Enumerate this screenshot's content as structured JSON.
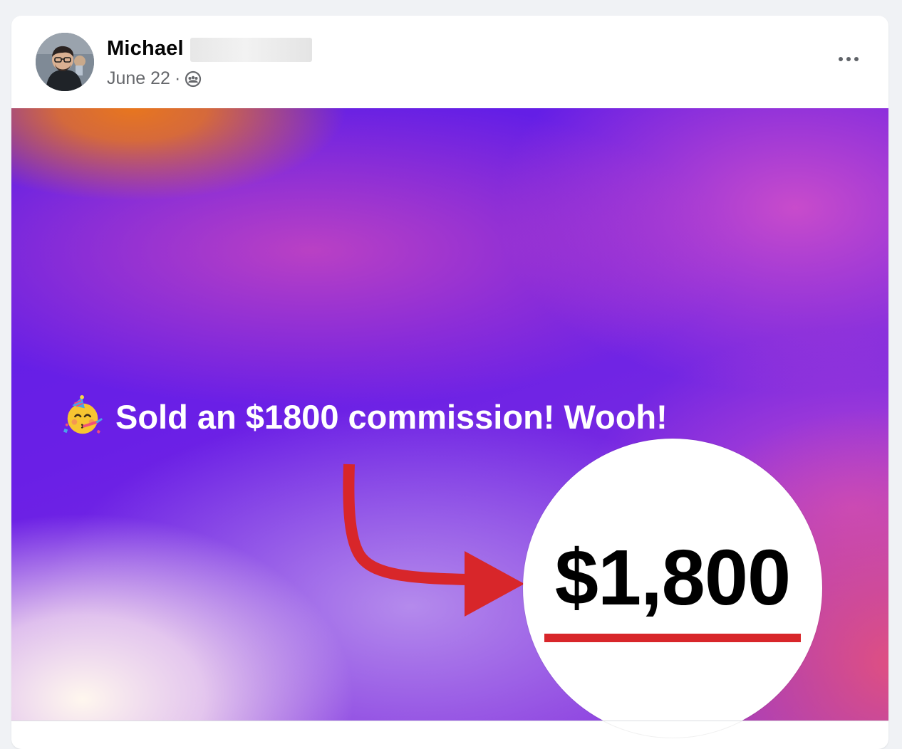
{
  "post": {
    "author": "Michael",
    "date": "June 22",
    "separator": "·",
    "audience_icon": "group-audience-icon",
    "more_icon": "more-options-icon"
  },
  "banner": {
    "emoji_icon": "partying-face-emoji-icon",
    "message": "Sold an $1800 commission! Wooh!",
    "highlight_amount": "$1,800",
    "arrow_color": "#d8262a",
    "underline_color": "#d8262a",
    "text_color": "#ffffff"
  }
}
